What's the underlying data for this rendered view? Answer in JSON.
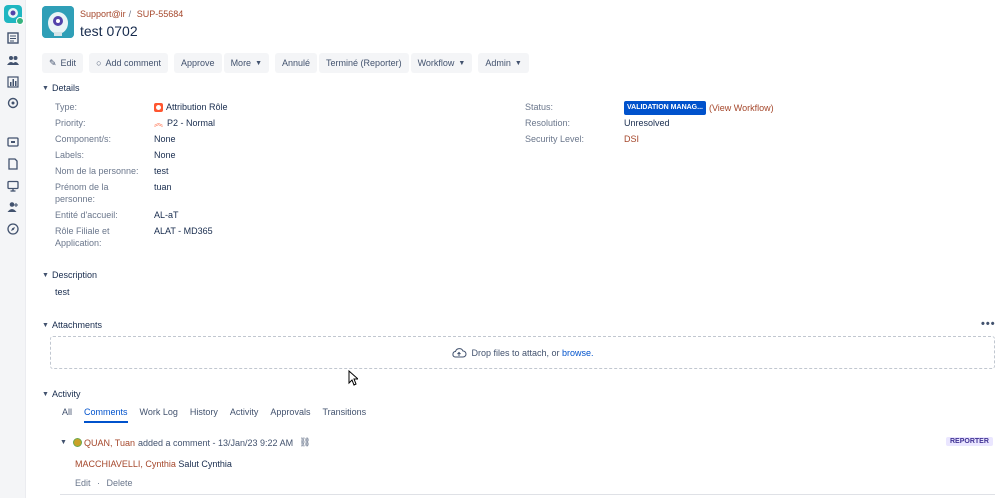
{
  "project": {
    "name": "Support@ir",
    "issue_key": "SUP-55684",
    "issue_title": "test 0702"
  },
  "toolbar": {
    "edit_label": "Edit",
    "add_comment_label": "Add comment",
    "approve_label": "Approve",
    "more_label": "More",
    "annule_label": "Annulé",
    "termine_label": "Terminé (Reporter)",
    "workflow_label": "Workflow",
    "admin_label": "Admin"
  },
  "details": {
    "heading": "Details",
    "fields": {
      "type_label": "Type:",
      "type_value": "Attribution Rôle",
      "priority_label": "Priority:",
      "priority_value": "P2 - Normal",
      "components_label": "Component/s:",
      "components_value": "None",
      "labels_label": "Labels:",
      "labels_value": "None",
      "nom_label": "Nom de la personne:",
      "nom_value": "test",
      "prenom_label": "Prénom de la personne:",
      "prenom_value": "tuan",
      "entite_label": "Entité d'accueil:",
      "entite_value": "AL-aT",
      "role_label": "Rôle Filiale et Application:",
      "role_value": "ALAT - MD365"
    },
    "right": {
      "status_label": "Status:",
      "status_value": "VALIDATION MANAG...",
      "view_workflow": "(View Workflow)",
      "resolution_label": "Resolution:",
      "resolution_value": "Unresolved",
      "security_label": "Security Level:",
      "security_value": "DSI"
    }
  },
  "description": {
    "heading": "Description",
    "text": "test"
  },
  "attachments": {
    "heading": "Attachments",
    "more": "•••",
    "drop_text": "Drop files to attach, or ",
    "browse": "browse."
  },
  "activity": {
    "heading": "Activity",
    "tabs": [
      "All",
      "Comments",
      "Work Log",
      "History",
      "Activity",
      "Approvals",
      "Transitions"
    ],
    "comment": {
      "author": "QUAN, Tuan",
      "meta": "added a comment - 13/Jan/23 9:22 AM",
      "badge": "REPORTER",
      "mention": "MACCHIAVELLI, Cynthia",
      "body": " Salut Cynthia",
      "edit": "Edit",
      "sep": "·",
      "delete": "Delete"
    }
  },
  "colors": {
    "accent": "#0052cc",
    "link": "#a5472b",
    "status": "#0052cc",
    "badge_bg": "#eae6ff"
  }
}
